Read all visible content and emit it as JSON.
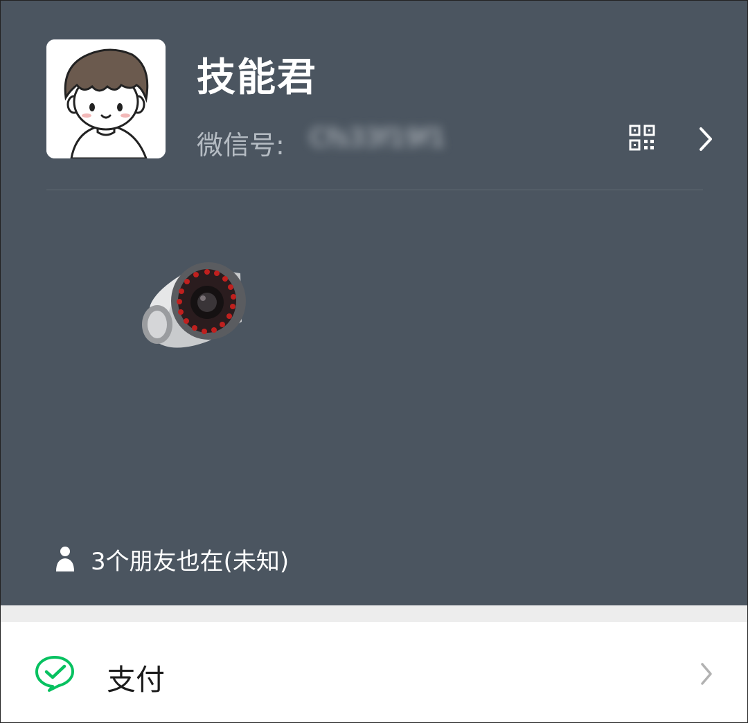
{
  "profile": {
    "nickname": "技能君",
    "wechat_id_label": "微信号:",
    "wechat_id_value": "Cfs33f19f1",
    "qr_icon": "qr-code-icon",
    "chevron_icon": "chevron-right-icon",
    "status_sticker": "security-camera-icon",
    "friends_icon": "person-icon",
    "friends_status": "3个朋友也在(未知)",
    "background_color": "#4b5560"
  },
  "menu": {
    "items": [
      {
        "label": "支付",
        "icon": "wechat-pay-icon",
        "icon_color": "#07c160"
      }
    ]
  }
}
